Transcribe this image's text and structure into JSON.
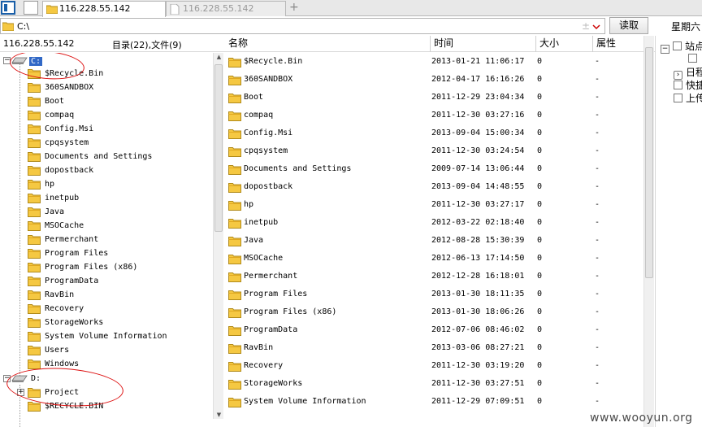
{
  "tabs": [
    {
      "label": "116.228.55.142",
      "active": true
    },
    {
      "label": "116.228.55.142",
      "active": false
    }
  ],
  "address": {
    "path": "C:\\",
    "up_glyph": "±",
    "read_button": "读取",
    "weekday": "星期六"
  },
  "left_header": {
    "server": "116.228.55.142",
    "counts": "目录(22),文件(9)"
  },
  "columns": {
    "name": "名称",
    "time": "时间",
    "size": "大小",
    "attr": "属性"
  },
  "tree": {
    "drive_c": "C:",
    "c_children": [
      "$Recycle.Bin",
      "360SANDBOX",
      "Boot",
      "compaq",
      "Config.Msi",
      "cpqsystem",
      "Documents and Settings",
      "dopostback",
      "hp",
      "inetpub",
      "Java",
      "MSOCache",
      "Permerchant",
      "Program Files",
      "Program Files (x86)",
      "ProgramData",
      "RavBin",
      "Recovery",
      "StorageWorks",
      "System Volume Information",
      "Users",
      "Windows"
    ],
    "drive_d": "D:",
    "d_children": [
      "Project",
      "$RECYCLE.BIN"
    ]
  },
  "files": [
    {
      "name": "$Recycle.Bin",
      "time": "2013-01-21 11:06:17",
      "size": "0",
      "attr": "-"
    },
    {
      "name": "360SANDBOX",
      "time": "2012-04-17 16:16:26",
      "size": "0",
      "attr": "-"
    },
    {
      "name": "Boot",
      "time": "2011-12-29 23:04:34",
      "size": "0",
      "attr": "-"
    },
    {
      "name": "compaq",
      "time": "2011-12-30 03:27:16",
      "size": "0",
      "attr": "-"
    },
    {
      "name": "Config.Msi",
      "time": "2013-09-04 15:00:34",
      "size": "0",
      "attr": "-"
    },
    {
      "name": "cpqsystem",
      "time": "2011-12-30 03:24:54",
      "size": "0",
      "attr": "-"
    },
    {
      "name": "Documents and Settings",
      "time": "2009-07-14 13:06:44",
      "size": "0",
      "attr": "-"
    },
    {
      "name": "dopostback",
      "time": "2013-09-04 14:48:55",
      "size": "0",
      "attr": "-"
    },
    {
      "name": "hp",
      "time": "2011-12-30 03:27:17",
      "size": "0",
      "attr": "-"
    },
    {
      "name": "inetpub",
      "time": "2012-03-22 02:18:40",
      "size": "0",
      "attr": "-"
    },
    {
      "name": "Java",
      "time": "2012-08-28 15:30:39",
      "size": "0",
      "attr": "-"
    },
    {
      "name": "MSOCache",
      "time": "2012-06-13 17:14:50",
      "size": "0",
      "attr": "-"
    },
    {
      "name": "Permerchant",
      "time": "2012-12-28 16:18:01",
      "size": "0",
      "attr": "-"
    },
    {
      "name": "Program Files",
      "time": "2013-01-30 18:11:35",
      "size": "0",
      "attr": "-"
    },
    {
      "name": "Program Files (x86)",
      "time": "2013-01-30 18:06:26",
      "size": "0",
      "attr": "-"
    },
    {
      "name": "ProgramData",
      "time": "2012-07-06 08:46:02",
      "size": "0",
      "attr": "-"
    },
    {
      "name": "RavBin",
      "time": "2013-03-06 08:27:21",
      "size": "0",
      "attr": "-"
    },
    {
      "name": "Recovery",
      "time": "2011-12-30 03:19:20",
      "size": "0",
      "attr": "-"
    },
    {
      "name": "StorageWorks",
      "time": "2011-12-30 03:27:51",
      "size": "0",
      "attr": "-"
    },
    {
      "name": "System Volume Information",
      "time": "2011-12-29 07:09:51",
      "size": "0",
      "attr": "-"
    }
  ],
  "right_panel": {
    "items": [
      "站点",
      "日程",
      "快捷",
      "上传"
    ]
  },
  "watermark": "www.wooyun.org",
  "colors": {
    "selection": "#3168c6",
    "annotation": "#d11111",
    "folder": "#f5c842"
  }
}
